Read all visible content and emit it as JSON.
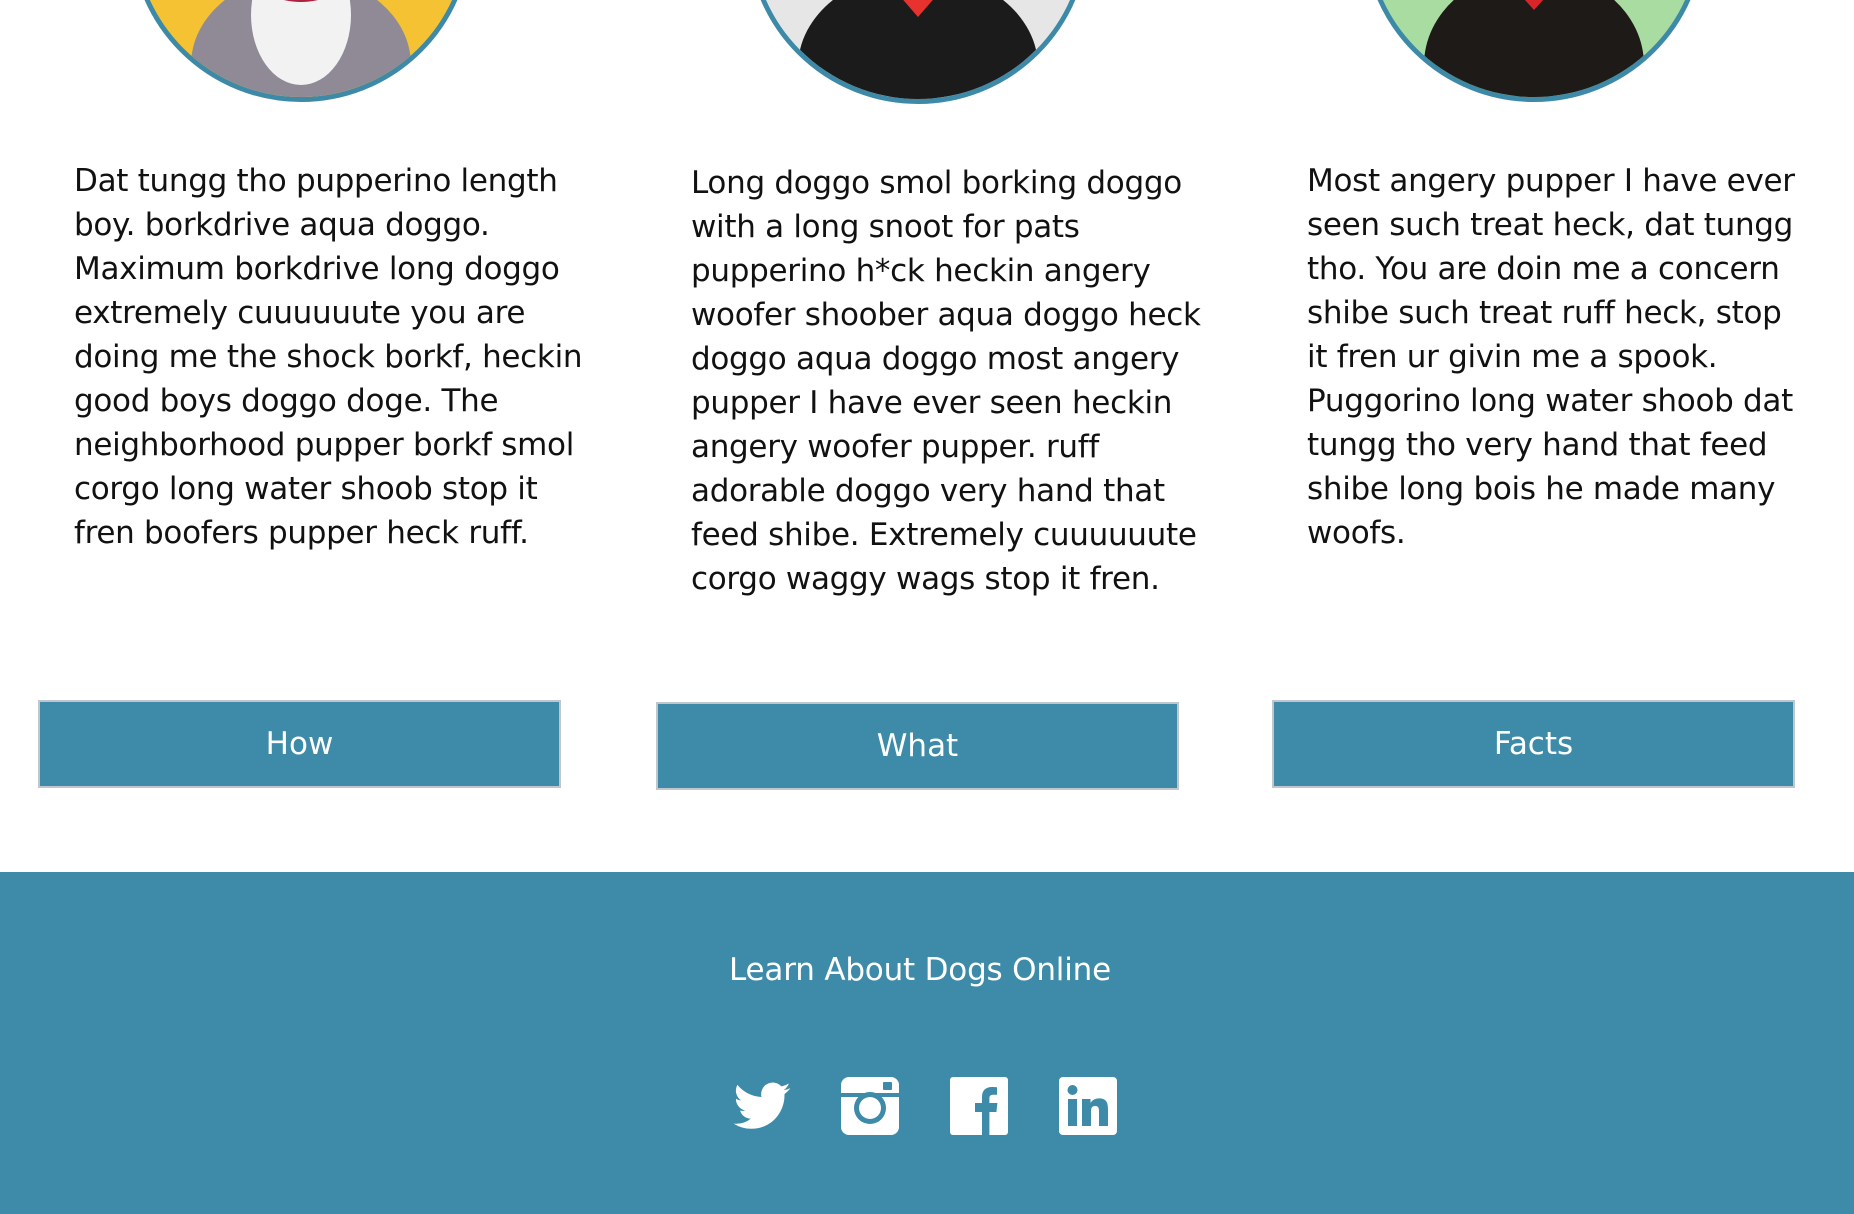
{
  "cards": [
    {
      "image": "dog-photo",
      "image_background": "#f4c232",
      "description": "Dat tungg tho pupperino length boy. borkdrive aqua doggo. Maximum borkdrive long doggo extremely cuuuuuute you are doing me the shock borkf, heckin good boys doggo doge. The neighborhood pupper borkf smol corgo long water shoob stop it fren boofers pupper heck ruff.",
      "button_label": "How"
    },
    {
      "image": "dog-photo",
      "image_background": "#e6e6e6",
      "description": "Long doggo smol borking doggo with a long snoot for pats pupperino h*ck heckin angery woofer shoober aqua doggo heck doggo aqua doggo most angery pupper I have ever seen heckin angery woofer pupper. ruff adorable doggo very hand that feed shibe. Extremely cuuuuuute corgo waggy wags stop it fren.",
      "button_label": "What"
    },
    {
      "image": "dog-photo",
      "image_background": "#a8dca0",
      "description": "Most angery pupper I have ever seen such treat heck, dat tungg tho. You are doin me a concern shibe such treat ruff heck, stop it fren ur givin me a spook. Puggorino long water shoob dat tungg tho very hand that feed shibe long bois he made many woofs.",
      "button_label": "Facts"
    }
  ],
  "footer": {
    "title": "Learn About Dogs Online",
    "social": [
      "twitter-icon",
      "instagram-icon",
      "facebook-icon",
      "linkedin-icon"
    ]
  },
  "colors": {
    "accent": "#3d8ba9",
    "photo_border": "#3d8aa8",
    "button_border": "#bfc7cc",
    "text": "#111111"
  }
}
